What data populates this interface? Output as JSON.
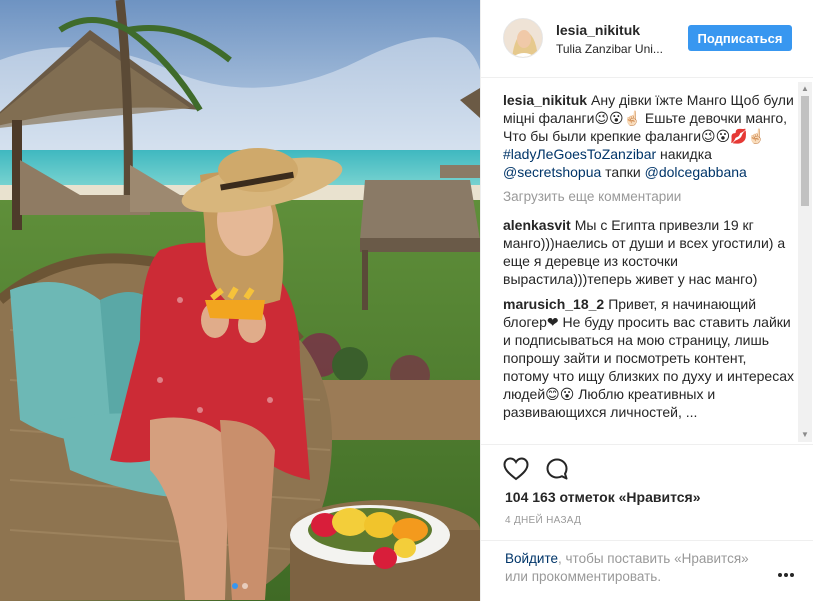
{
  "post": {
    "header": {
      "username": "lesia_nikituk",
      "location": "Tulia Zanzibar Uni...",
      "follow_label": "Подписаться"
    },
    "caption": {
      "author": "lesia_nikituk",
      "text_1": "Ану дівки їжте Манго Щоб були міцні фаланги😉😮☝🏻 Ешьте девочки манго, Что бы были крепкие фаланги😉😮💋☝🏻 ",
      "hashtag": "#ladyЛеGoesToZanzibar",
      "text_2": " накидка ",
      "mention_1": "@secretshopua",
      "text_3": " тапки ",
      "mention_2": "@dolcegabbana"
    },
    "load_more": "Загрузить еще комментарии",
    "comments": [
      {
        "author": "alenkasvit",
        "text": "Мы с Египта привезли 19 кг манго)))наелись от души и всех угостили) а еще я деревце из косточки вырастила)))теперь живет у нас манго)"
      },
      {
        "author": "marusich_18_2",
        "text": "Привет, я начинающий блогер❤ Не буду просить вас ставить лайки и подписываться на мою страницу, лишь попрошу зайти и посмотреть контент, потому что ищу близких по духу и интересах людей😊😮 Люблю креативных и развивающихся личностей, ..."
      }
    ],
    "likes": "104 163 отметок «Нравится»",
    "timestamp": "4 ДНЕЙ НАЗАД",
    "footer": {
      "login_link": "Войдите",
      "login_text": ", чтобы поставить «Нравится» или прокомментировать."
    },
    "carousel": {
      "count": 2,
      "active_index": 0
    },
    "icons": [
      "heart-icon",
      "comment-icon",
      "more-options-icon"
    ],
    "colors": {
      "follow_button": "#3897f0",
      "link": "#003569",
      "muted": "#999999"
    }
  }
}
